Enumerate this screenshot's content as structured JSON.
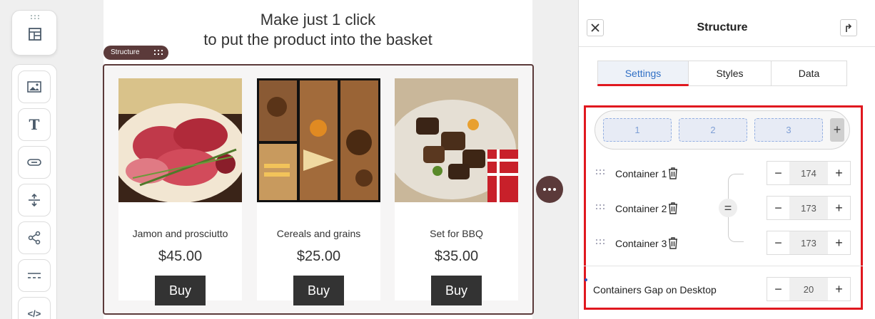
{
  "canvas": {
    "headline_line1": "Make just 1 click",
    "headline_line2": "to put the product into the basket",
    "structure_tag": "Structure",
    "products": [
      {
        "name": "Jamon and prosciutto",
        "price": "$45.00",
        "button": "Buy"
      },
      {
        "name": "Cereals and grains",
        "price": "$25.00",
        "button": "Buy"
      },
      {
        "name": "Set for BBQ",
        "price": "$35.00",
        "button": "Buy"
      }
    ]
  },
  "panel": {
    "title": "Structure",
    "tabs": [
      {
        "label": "Settings",
        "active": true
      },
      {
        "label": "Styles",
        "active": false
      },
      {
        "label": "Data",
        "active": false
      }
    ],
    "column_buttons": [
      "1",
      "2",
      "3"
    ],
    "add_column": "+",
    "containers": [
      {
        "label": "Container 1",
        "value": "174"
      },
      {
        "label": "Container 2",
        "value": "173"
      },
      {
        "label": "Container 3",
        "value": "173"
      }
    ],
    "equalize_symbol": "=",
    "minus": "−",
    "plus": "+",
    "gap": {
      "label": "Containers Gap on Desktop",
      "value": "20"
    }
  },
  "colors": {
    "accent": "#5b3a3a",
    "highlight": "#e0181f",
    "active_tab": "#2f6fc5"
  },
  "icons": [
    "grip-icon",
    "structure-icon",
    "image-block-icon",
    "text-block-icon",
    "button-block-icon",
    "spacer-icon",
    "social-icon",
    "divider-icon",
    "html-code-icon",
    "close-icon",
    "return-icon",
    "drag-handle-icon",
    "trash-icon",
    "more-icon"
  ]
}
